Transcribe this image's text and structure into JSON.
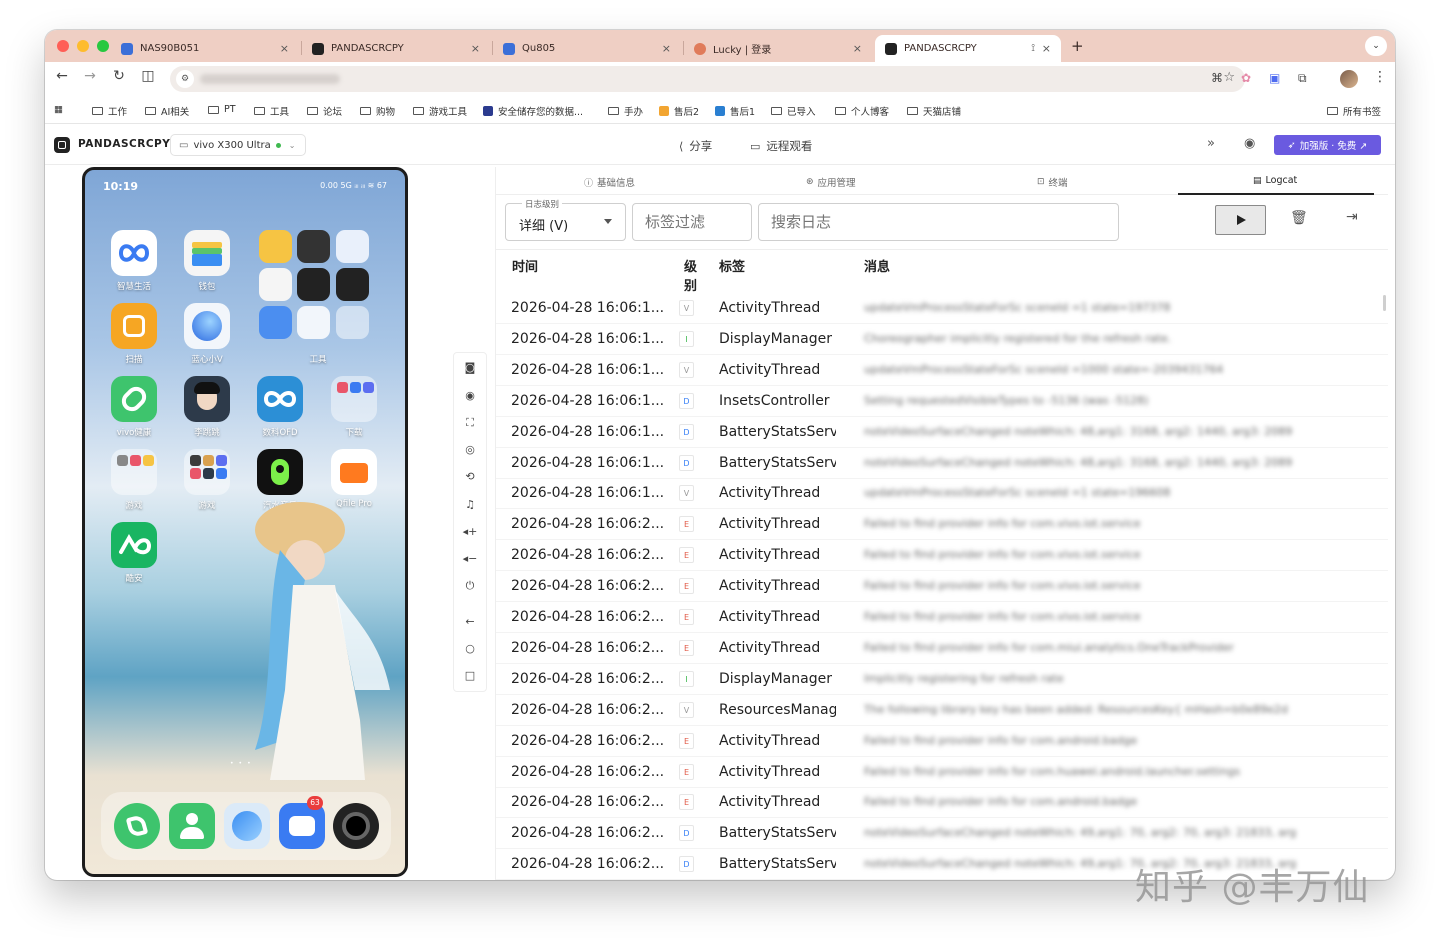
{
  "browser": {
    "tabs": [
      {
        "title": "NAS90B051",
        "color": "#3b6fd8"
      },
      {
        "title": "PANDASCRCPY",
        "color": "#222222"
      },
      {
        "title": "Qu805",
        "color": "#3b6fd8"
      },
      {
        "title": "Lucky | 登录",
        "color": "#e07b5a"
      },
      {
        "title": "PANDASCRCPY",
        "color": "#222222"
      }
    ],
    "tab_close": "×",
    "new_tab": "+",
    "bookmarks": [
      {
        "label": "工作",
        "type": "folder"
      },
      {
        "label": "AI相关",
        "type": "folder"
      },
      {
        "label": "PT",
        "type": "folder"
      },
      {
        "label": "工具",
        "type": "folder"
      },
      {
        "label": "论坛",
        "type": "folder"
      },
      {
        "label": "购物",
        "type": "folder"
      },
      {
        "label": "游戏工具",
        "type": "folder"
      },
      {
        "label": "安全储存您的数据...",
        "type": "site",
        "color": "#2b3b8f"
      },
      {
        "label": "手办",
        "type": "folder"
      },
      {
        "label": "售后2",
        "type": "site",
        "color": "#f2a531"
      },
      {
        "label": "售后1",
        "type": "site",
        "color": "#2a7fd1"
      },
      {
        "label": "已导入",
        "type": "folder"
      },
      {
        "label": "个人博客",
        "type": "folder"
      },
      {
        "label": "天猫店铺",
        "type": "folder"
      }
    ],
    "all_bookmarks": "所有书签"
  },
  "app": {
    "name": "PANDASCRCPY",
    "device": "vivo X300 Ultra",
    "share": "分享",
    "remote_view": "远程观看",
    "pro_button": "加强版 · 免费 ↗",
    "tabs": [
      "基础信息",
      "应用管理",
      "终端",
      "Logcat"
    ]
  },
  "phone": {
    "time": "10:19",
    "status_right": "0.00 5G ᵢₗₗ ᵢₗₗ ≋ 67",
    "apps": [
      {
        "label": "智慧生活",
        "color": "#ffffff"
      },
      {
        "label": "钱包",
        "color": "#f5f5f5"
      },
      {
        "label": "扫描",
        "color": "#f6a623"
      },
      {
        "label": "蓝心小V",
        "color": "#f2f6fb"
      },
      {
        "label": "vivo健康",
        "color": "#3ec46d"
      },
      {
        "label": "李跳跳",
        "color": "#2d3a4a"
      },
      {
        "label": "数科OFD",
        "color": "#2c8fd6"
      },
      {
        "label": "汽水音乐",
        "color": "#111111"
      },
      {
        "label": "Qfile Pro",
        "color": "#ff7a1f"
      },
      {
        "label": "酷安",
        "color": "#19b562"
      }
    ],
    "folders": [
      "工具",
      "下载",
      "游戏",
      "游戏"
    ],
    "dock_badge": "63"
  },
  "logcat": {
    "level_legend": "日志级别",
    "level_value": "详细 (V)",
    "tag_placeholder": "标签过滤",
    "search_placeholder": "搜索日志",
    "columns": {
      "time": "时间",
      "level": "级\n别",
      "tag": "标签",
      "message": "消息"
    },
    "level_colors": {
      "V": "#9a9a9a",
      "I": "#3fb950",
      "D": "#3b82f6",
      "E": "#e25c4a"
    },
    "rows": [
      {
        "time": "2026-04-28 16:06:1...",
        "level": "V",
        "tag": "ActivityThread",
        "msg": "updateVmProcessStateForSc sceneId =1 state=197378"
      },
      {
        "time": "2026-04-28 16:06:1...",
        "level": "I",
        "tag": "DisplayManager",
        "msg": "Choreographer implicitly registered for the refresh rate."
      },
      {
        "time": "2026-04-28 16:06:1...",
        "level": "V",
        "tag": "ActivityThread",
        "msg": "updateVmProcessStateForSc sceneId =1000 state=-2039431764"
      },
      {
        "time": "2026-04-28 16:06:1...",
        "level": "D",
        "tag": "InsetsController",
        "msg": "Setting requestedVisibleTypes to -5136 (was -5128)"
      },
      {
        "time": "2026-04-28 16:06:1...",
        "level": "D",
        "tag": "BatteryStatsServi...",
        "msg": "noteVideoSurfaceChanged noteWhich: 48,arg1: 3168, arg2: 1440, arg3: 2089"
      },
      {
        "time": "2026-04-28 16:06:1...",
        "level": "D",
        "tag": "BatteryStatsServi...",
        "msg": "noteVideoSurfaceChanged noteWhich: 48,arg1: 3168, arg2: 1440, arg3: 2089"
      },
      {
        "time": "2026-04-28 16:06:1...",
        "level": "V",
        "tag": "ActivityThread",
        "msg": "updateVmProcessStateForSc sceneId =1 state=196608"
      },
      {
        "time": "2026-04-28 16:06:2...",
        "level": "E",
        "tag": "ActivityThread",
        "msg": "Failed to find provider info for com.vivo.iot.service"
      },
      {
        "time": "2026-04-28 16:06:2...",
        "level": "E",
        "tag": "ActivityThread",
        "msg": "Failed to find provider info for com.vivo.iot.service"
      },
      {
        "time": "2026-04-28 16:06:2...",
        "level": "E",
        "tag": "ActivityThread",
        "msg": "Failed to find provider info for com.vivo.iot.service"
      },
      {
        "time": "2026-04-28 16:06:2...",
        "level": "E",
        "tag": "ActivityThread",
        "msg": "Failed to find provider info for com.vivo.iot.service"
      },
      {
        "time": "2026-04-28 16:06:2...",
        "level": "E",
        "tag": "ActivityThread",
        "msg": "Failed to find provider info for com.miui.analytics.OneTrackProvider"
      },
      {
        "time": "2026-04-28 16:06:2...",
        "level": "I",
        "tag": "DisplayManager",
        "msg": "Implicitly registering for refresh rate"
      },
      {
        "time": "2026-04-28 16:06:2...",
        "level": "V",
        "tag": "ResourcesManag...",
        "msg": "The following library key has been added: ResourcesKey{ mHash=b0e89e2d"
      },
      {
        "time": "2026-04-28 16:06:2...",
        "level": "E",
        "tag": "ActivityThread",
        "msg": "Failed to find provider info for com.android.badge"
      },
      {
        "time": "2026-04-28 16:06:2...",
        "level": "E",
        "tag": "ActivityThread",
        "msg": "Failed to find provider info for com.huawei.android.launcher.settings"
      },
      {
        "time": "2026-04-28 16:06:2...",
        "level": "E",
        "tag": "ActivityThread",
        "msg": "Failed to find provider info for com.android.badge"
      },
      {
        "time": "2026-04-28 16:06:2...",
        "level": "D",
        "tag": "BatteryStatsServi...",
        "msg": "noteVideoSurfaceChanged noteWhich: 49,arg1: 70, arg2: 70, arg3: 21833, arg"
      },
      {
        "time": "2026-04-28 16:06:2...",
        "level": "D",
        "tag": "BatteryStatsServi...",
        "msg": "noteVideoSurfaceChanged noteWhich: 49,arg1: 70, arg2: 70, arg3: 21833, arg"
      }
    ]
  },
  "watermark": "知乎 @丰万仙"
}
